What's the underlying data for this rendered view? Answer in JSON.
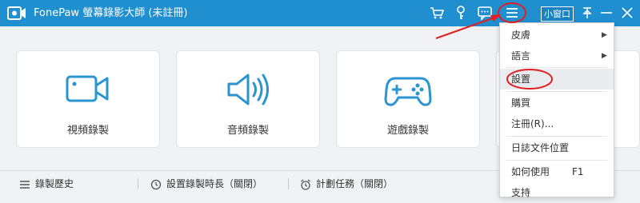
{
  "titlebar": {
    "title": "FonePaw 螢幕錄影大師 (未註冊)",
    "mini_label": "小窗口",
    "icons": [
      "cart-icon",
      "key-icon",
      "chat-icon",
      "menu-icon",
      "pin-icon",
      "minimize-icon",
      "close-icon"
    ]
  },
  "cards": [
    {
      "label": "視頻錄製",
      "icon": "video-camera-icon"
    },
    {
      "label": "音頻錄製",
      "icon": "speaker-icon"
    },
    {
      "label": "遊戲錄製",
      "icon": "gamepad-icon"
    }
  ],
  "footer": {
    "history_label": "錄製歷史",
    "duration_label": "設置錄製時長（關閉）",
    "schedule_label": "計劃任務（關閉）"
  },
  "menu": {
    "items": [
      {
        "label": "皮膚",
        "submenu": true
      },
      {
        "label": "語言",
        "submenu": true
      },
      {
        "label": "設置",
        "highlighted": true
      },
      {
        "label": "購買"
      },
      {
        "label": "注冊(R)..."
      },
      {
        "label": "日誌文件位置"
      },
      {
        "label": "如何使用",
        "shortcut": "F1"
      },
      {
        "label": "支持"
      }
    ]
  },
  "colors": {
    "titlebar": "#1f8fcf",
    "icon_accent": "#2a95cf",
    "annotation_red": "#e02020"
  }
}
